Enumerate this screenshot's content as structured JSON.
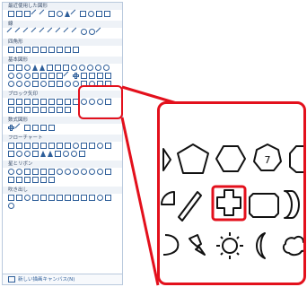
{
  "panel": {
    "categories": [
      {
        "label": "最近使用した図形"
      },
      {
        "label": "線"
      },
      {
        "label": "四角形"
      },
      {
        "label": "基本図形"
      },
      {
        "label": "ブロック矢印"
      },
      {
        "label": "数式図形"
      },
      {
        "label": "フローチャート"
      },
      {
        "label": "星とリボン"
      },
      {
        "label": "吹き出し"
      }
    ],
    "footer_label": "新しい描画キャンバス(N)"
  },
  "zoom": {
    "selected_shape": "cross",
    "octagon_digit": "7"
  },
  "colors": {
    "accent": "#e3101c",
    "shape_stroke": "#2f5f9a",
    "zoom_stroke": "#111111"
  }
}
